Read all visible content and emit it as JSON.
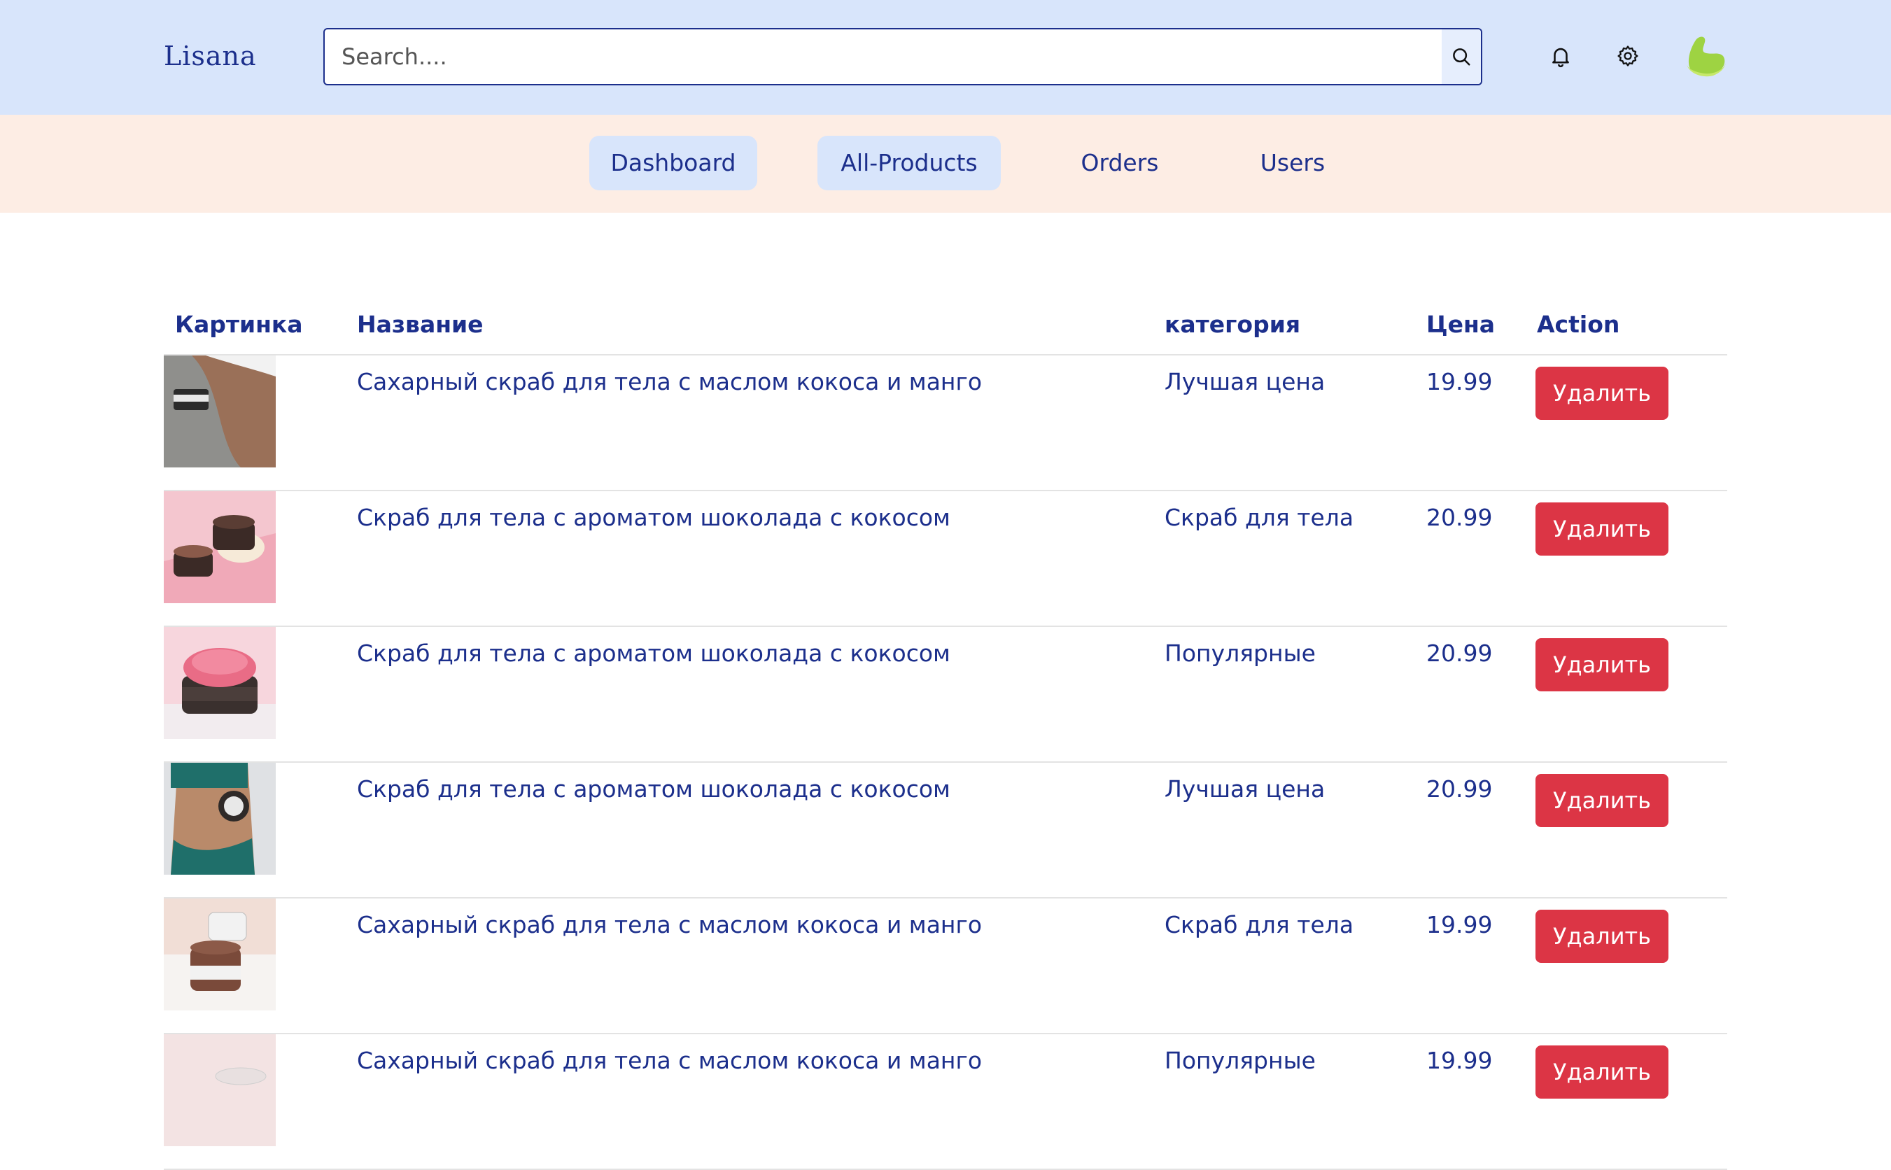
{
  "brand": {
    "logo": "Lisana"
  },
  "search": {
    "placeholder": "Search...."
  },
  "nav": {
    "items": [
      {
        "label": "Dashboard"
      },
      {
        "label": "All-Products"
      },
      {
        "label": "Orders"
      },
      {
        "label": "Users"
      }
    ]
  },
  "table": {
    "headers": {
      "image": "Картинка",
      "name": "Название",
      "category": "категория",
      "price": "Цена",
      "action": "Action"
    },
    "rows": [
      {
        "name": "Сахарный скраб для тела с маслом кокоса и манго",
        "category": "Лучшая цена",
        "price": "19.99",
        "action": "Удалить"
      },
      {
        "name": "Скраб для тела с ароматом шоколада с кокосом",
        "category": "Скраб для тела",
        "price": "20.99",
        "action": "Удалить"
      },
      {
        "name": "Скраб для тела с ароматом шоколада с кокосом",
        "category": "Популярные",
        "price": "20.99",
        "action": "Удалить"
      },
      {
        "name": "Скраб для тела с ароматом шоколада с кокосом",
        "category": "Лучшая цена",
        "price": "20.99",
        "action": "Удалить"
      },
      {
        "name": "Сахарный скраб для тела с маслом кокоса и манго",
        "category": "Скраб для тела",
        "price": "19.99",
        "action": "Удалить"
      },
      {
        "name": "Сахарный скраб для тела с маслом кокоса и манго",
        "category": "Популярные",
        "price": "19.99",
        "action": "Удалить"
      }
    ]
  },
  "colors": {
    "header_bg": "#d8e5fb",
    "nav_bg": "#fdede4",
    "text_primary": "#1c2f8c",
    "danger": "#dc3545",
    "avatar": "#9ed342"
  },
  "icons": {
    "search": "search-icon",
    "notifications": "bell-icon",
    "settings": "gear-icon",
    "profile": "avatar"
  }
}
